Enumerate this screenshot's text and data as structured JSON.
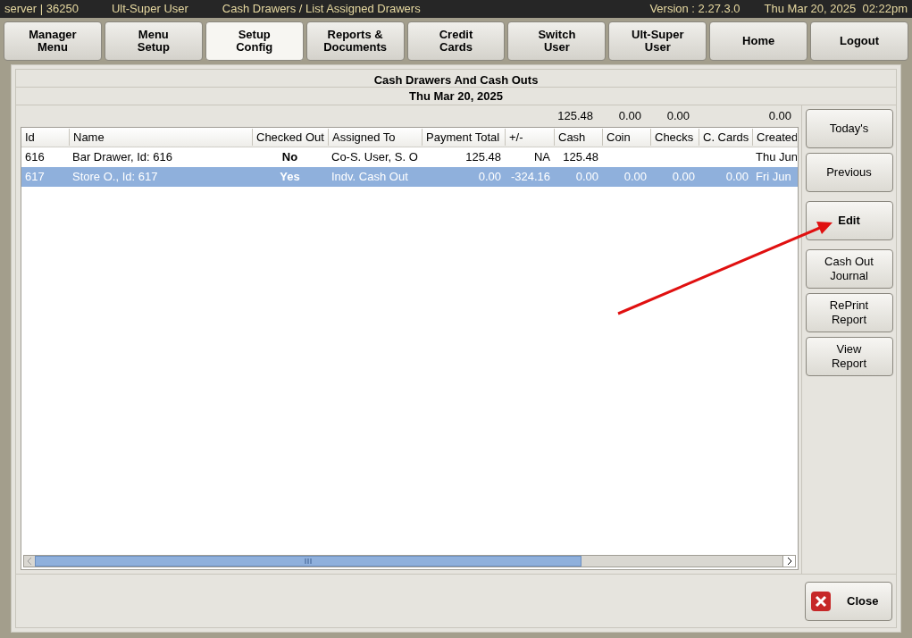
{
  "status_bar": {
    "server": "server | 36250",
    "user": "Ult-Super User",
    "path": "Cash Drawers / List Assigned Drawers",
    "version": "Version : 2.27.3.0",
    "datetime": "Thu Mar 20, 2025  02:22pm"
  },
  "nav": [
    {
      "label": "Manager\nMenu",
      "selected": false
    },
    {
      "label": "Menu\nSetup",
      "selected": false
    },
    {
      "label": "Setup\nConfig",
      "selected": true
    },
    {
      "label": "Reports &\nDocuments",
      "selected": false
    },
    {
      "label": "Credit\nCards",
      "selected": false
    },
    {
      "label": "Switch\nUser",
      "selected": false
    },
    {
      "label": "Ult-Super\nUser",
      "selected": false
    },
    {
      "label": "Home",
      "selected": false
    },
    {
      "label": "Logout",
      "selected": false
    }
  ],
  "title": "Cash Drawers And Cash Outs",
  "date": "Thu Mar 20, 2025",
  "totals": [
    "125.48",
    "0.00",
    "0.00",
    "0.00"
  ],
  "table": {
    "columns": [
      "Id",
      "Name",
      "Checked Out",
      "Assigned To",
      "Payment Total",
      "+/-",
      "Cash",
      "Coin",
      "Checks",
      "C. Cards",
      "Created"
    ],
    "rows": [
      {
        "selected": false,
        "cells": [
          "616",
          "Bar Drawer, Id: 616",
          "No",
          "Co-S. User, S. O",
          "125.48",
          "NA",
          "125.48",
          "",
          "",
          "",
          "Thu Jun"
        ]
      },
      {
        "selected": true,
        "cells": [
          "617",
          "Store O., Id: 617",
          "Yes",
          "Indv. Cash Out",
          "0.00",
          "-324.16",
          "0.00",
          "0.00",
          "0.00",
          "0.00",
          "Fri Jun"
        ]
      }
    ]
  },
  "side_buttons": [
    {
      "label": "Today's",
      "default": false
    },
    {
      "label": "Previous",
      "default": false
    },
    {
      "label": "Edit",
      "default": true
    },
    {
      "label": "Cash Out\nJournal",
      "default": false
    },
    {
      "label": "RePrint\nReport",
      "default": false
    },
    {
      "label": "View\nReport",
      "default": false
    }
  ],
  "close_button": "Close"
}
